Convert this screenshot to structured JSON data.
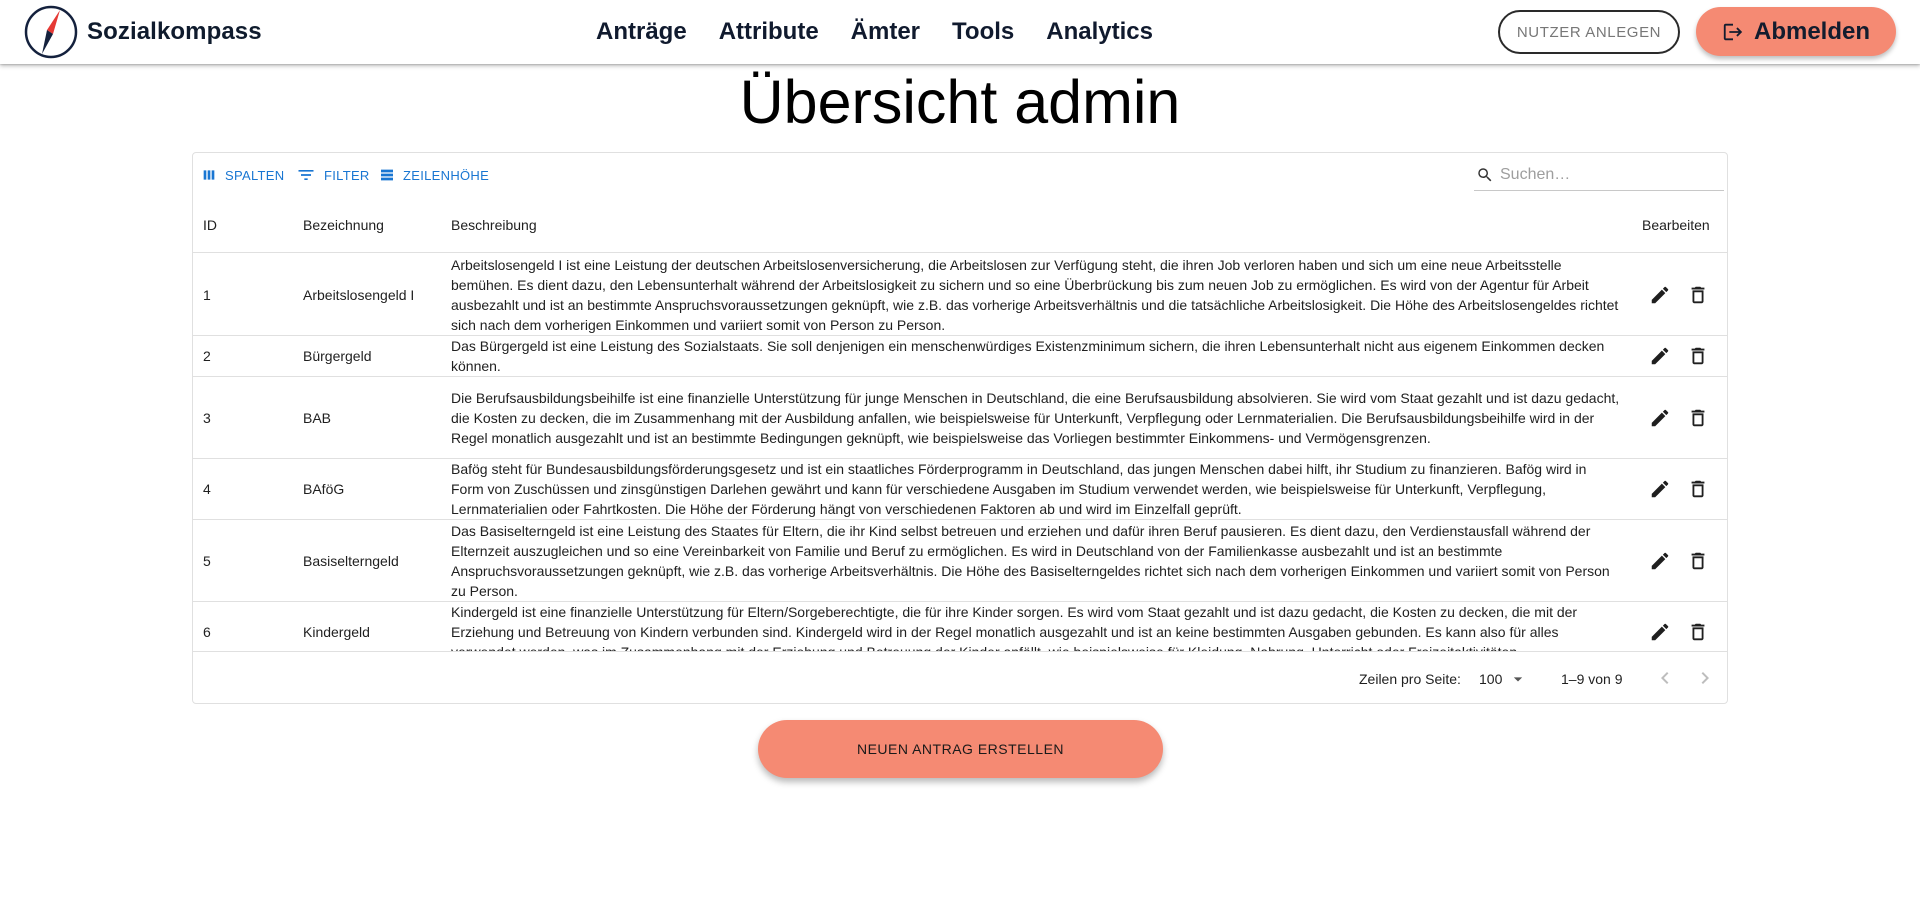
{
  "brand": {
    "name": "Sozialkompass",
    "logo_icon": "compass-logo-icon"
  },
  "nav": [
    {
      "label": "Anträge"
    },
    {
      "label": "Attribute"
    },
    {
      "label": "Ämter"
    },
    {
      "label": "Tools"
    },
    {
      "label": "Analytics"
    }
  ],
  "header_actions": {
    "create_user_label": "NUTZER ANLEGEN",
    "logout_label": "Abmelden",
    "logout_icon": "logout-icon"
  },
  "page_title": "Übersicht admin",
  "toolbar": {
    "columns_label": "SPALTEN",
    "filter_label": "FILTER",
    "density_label": "ZEILENHÖHE",
    "search_placeholder": "Suchen…"
  },
  "table": {
    "columns": [
      "ID",
      "Bezeichnung",
      "Beschreibung",
      "Bearbeiten"
    ],
    "rows": [
      {
        "id": "1",
        "name": "Arbeitslosengeld I",
        "desc": "Arbeitslosengeld I ist eine Leistung der deutschen Arbeitslosenversicherung, die Arbeitslosen zur Verfügung steht, die ihren Job verloren haben und sich um eine neue Arbeitsstelle bemühen. Es dient dazu, den Lebensunterhalt während der Arbeitslosigkeit zu sichern und so eine Überbrückung bis zum neuen Job zu ermöglichen. Es wird von der Agentur für Arbeit ausbezahlt und ist an bestimmte Anspruchsvoraussetzungen geknüpft, wie z.B. das vorherige Arbeitsverhältnis und die tatsächliche Arbeitslosigkeit. Die Höhe des Arbeitslosengeldes richtet sich nach dem vorherigen Einkommen und variiert somit von Person zu Person."
      },
      {
        "id": "2",
        "name": "Bürgergeld",
        "desc": "Das Bürgergeld ist eine Leistung des Sozialstaats. Sie soll denjenigen ein menschenwürdiges Existenzminimum sichern, die ihren Lebensunterhalt nicht aus eigenem Einkommen decken können."
      },
      {
        "id": "3",
        "name": "BAB",
        "desc": "Die Berufsausbildungsbeihilfe ist eine finanzielle Unterstützung für junge Menschen in Deutschland, die eine Berufsausbildung absolvieren. Sie wird vom Staat gezahlt und ist dazu gedacht, die Kosten zu decken, die im Zusammenhang mit der Ausbildung anfallen, wie beispielsweise für Unterkunft, Verpflegung oder Lernmaterialien. Die Berufsausbildungsbeihilfe wird in der Regel monatlich ausgezahlt und ist an bestimmte Bedingungen geknüpft, wie beispielsweise das Vorliegen bestimmter Einkommens- und Vermögensgrenzen."
      },
      {
        "id": "4",
        "name": "BAföG",
        "desc": "Bafög steht für Bundesausbildungsförderungsgesetz und ist ein staatliches Förderprogramm in Deutschland, das jungen Menschen dabei hilft, ihr Studium zu finanzieren. Bafög wird in Form von Zuschüssen und zinsgünstigen Darlehen gewährt und kann für verschiedene Ausgaben im Studium verwendet werden, wie beispielsweise für Unterkunft, Verpflegung, Lernmaterialien oder Fahrtkosten. Die Höhe der Förderung hängt von verschiedenen Faktoren ab und wird im Einzelfall geprüft."
      },
      {
        "id": "5",
        "name": "Basiselterngeld",
        "desc": "Das Basiselterngeld ist eine Leistung des Staates für Eltern, die ihr Kind selbst betreuen und erziehen und dafür ihren Beruf pausieren. Es dient dazu, den Verdienstausfall während der Elternzeit auszugleichen und so eine Vereinbarkeit von Familie und Beruf zu ermöglichen. Es wird in Deutschland von der Familienkasse ausbezahlt und ist an bestimmte Anspruchsvoraussetzungen geknüpft, wie z.B. das vorherige Arbeitsverhältnis. Die Höhe des Basiselterngeldes richtet sich nach dem vorherigen Einkommen und variiert somit von Person zu Person."
      },
      {
        "id": "6",
        "name": "Kindergeld",
        "desc": "Kindergeld ist eine finanzielle Unterstützung für Eltern/Sorgeberechtigte, die für ihre Kinder sorgen. Es wird vom Staat gezahlt und ist dazu gedacht, die Kosten zu decken, die mit der Erziehung und Betreuung von Kindern verbunden sind. Kindergeld wird in der Regel monatlich ausgezahlt und ist an keine bestimmten Ausgaben gebunden. Es kann also für alles verwendet werden, was im Zusammenhang mit der Erziehung und Betreuung der Kinder anfällt, wie beispielsweise für Kleidung, Nahrung, Unterricht oder Freizeitaktivitäten."
      }
    ],
    "row_icons": {
      "edit": "pencil-icon",
      "delete": "trash-icon"
    }
  },
  "pagination": {
    "rows_per_page_label": "Zeilen pro Seite:",
    "rows_per_page_value": "100",
    "range_label": "1–9 von 9"
  },
  "primary_action": {
    "label": "NEUEN ANTRAG ERSTELLEN"
  },
  "colors": {
    "accent": "#f58a73",
    "link": "#1976d2",
    "logo_red": "#e53935",
    "logo_navy": "#14213d"
  }
}
